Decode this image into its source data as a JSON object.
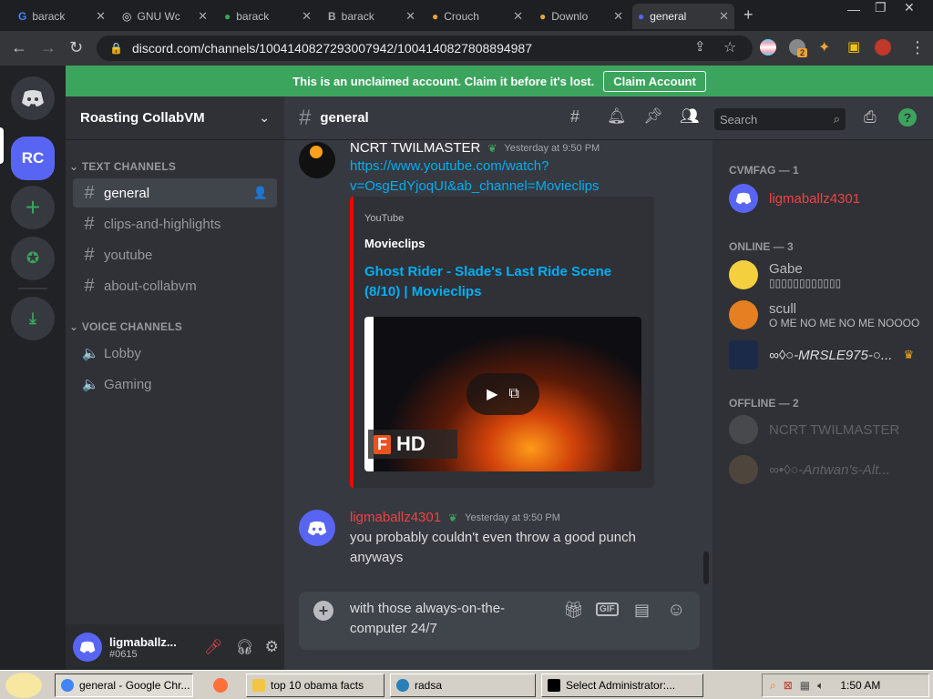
{
  "browser": {
    "tabs": [
      {
        "label": "barack",
        "icon": "google-icon"
      },
      {
        "label": "GNU Wc",
        "icon": "gnu-icon"
      },
      {
        "label": "barack",
        "icon": "chrome-icon"
      },
      {
        "label": "barack",
        "icon": "bing-icon"
      },
      {
        "label": "Crouch",
        "icon": "site-icon"
      },
      {
        "label": "Downlo",
        "icon": "site-icon"
      },
      {
        "label": "general",
        "icon": "discord-icon"
      }
    ],
    "url": "discord.com/channels/1004140827293007942/1004140827808894987",
    "extension_badge": "2"
  },
  "banner": {
    "text": "This is an unclaimed account. Claim it before it's lost.",
    "button": "Claim Account"
  },
  "guilds": {
    "server_initials": "RC"
  },
  "server": {
    "name": "Roasting CollabVM",
    "text_category": "TEXT CHANNELS",
    "text_channels": [
      "general",
      "clips-and-highlights",
      "youtube",
      "about-collabvm"
    ],
    "voice_category": "VOICE CHANNELS",
    "voice_channels": [
      "Lobby",
      "Gaming"
    ]
  },
  "user": {
    "name": "ligmaballz...",
    "tag": "#0615"
  },
  "chat": {
    "channel": "general",
    "search_placeholder": "Search",
    "messages": [
      {
        "author": "NCRT TWILMASTER",
        "author_color": "#ffffff",
        "time": "Yesterday at 9:50 PM",
        "link_line1": "https://www.youtube.com/watch?",
        "link_line2": "v=OsgEdYjoqUI&ab_channel=Movieclips",
        "embed": {
          "provider": "YouTube",
          "author": "Movieclips",
          "title_line1": "Ghost Rider - Slade's Last Ride Scene",
          "title_line2": "(8/10) | Movieclips",
          "badge": "HD"
        }
      },
      {
        "author": "ligmaballz4301",
        "author_color": "#ed4245",
        "time": "Yesterday at 9:50 PM",
        "text_line1": "you probably couldn't even throw a good punch",
        "text_line2": "anyways"
      }
    ],
    "composer": {
      "line1": "with those always-on-the-",
      "line2": "computer 24/7"
    }
  },
  "members": {
    "cat1": "CVMFAG — 1",
    "cat1_members": [
      {
        "name": "ligmaballz4301",
        "color": "#ed4245"
      }
    ],
    "cat2": "ONLINE — 3",
    "cat2_members": [
      {
        "name": "Gabe",
        "status": "▯▯▯▯▯▯▯▯▯▯▯▯",
        "color": "#b9bbbe"
      },
      {
        "name": "scull",
        "status": "O ME NO ME NO ME NOOOO",
        "color": "#b9bbbe"
      },
      {
        "name": "∞◊○-MRSLE975-○...",
        "color": "#dcddde"
      }
    ],
    "cat3": "OFFLINE — 2",
    "cat3_members": [
      {
        "name": "NCRT TWILMASTER"
      },
      {
        "name": "∞•◊○-Antwan's-Alt..."
      }
    ]
  },
  "taskbar": {
    "buttons": [
      "general - Google Chr...",
      "top 10 obama facts",
      "radsa",
      "Select Administrator:..."
    ],
    "time": "1:50 AM"
  }
}
